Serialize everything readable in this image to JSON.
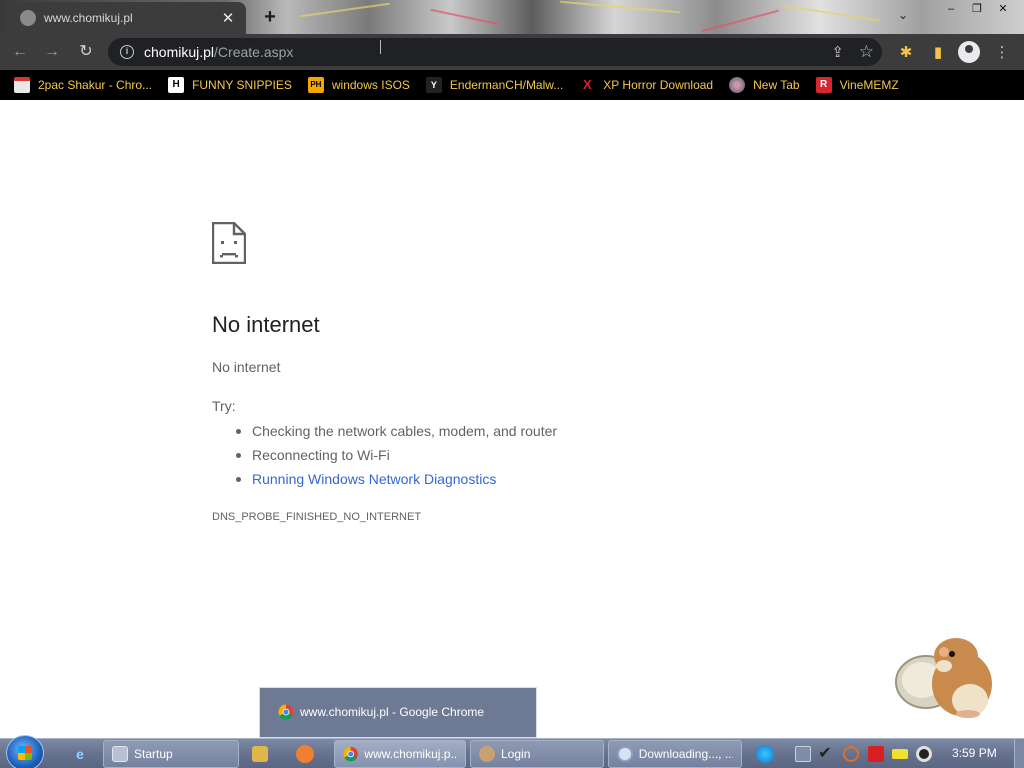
{
  "browser": {
    "tab": {
      "title": "www.chomikuj.pl"
    },
    "new_tab_symbol": "+",
    "window_controls": {
      "minimize": "–",
      "restore": "❐",
      "close": "✕"
    },
    "omnibox": {
      "host": "chomikuj.pl",
      "path": "/Create.aspx"
    },
    "bookmarks": [
      {
        "label": "2pac Shakur - Chro...",
        "icon": "calendar-icon"
      },
      {
        "label": "FUNNY SNIPPIES",
        "icon": "h-logo-icon",
        "glyph": "H"
      },
      {
        "label": "windows ISOS",
        "icon": "ph-logo-icon",
        "glyph": "PH"
      },
      {
        "label": "EndermanCH/Malw...",
        "icon": "yp-logo-icon",
        "glyph": "Y"
      },
      {
        "label": "XP Horror Download",
        "icon": "x-logo-icon",
        "glyph": "X"
      },
      {
        "label": "New Tab",
        "icon": "globe-icon"
      },
      {
        "label": "VineMEMZ",
        "icon": "r-logo-icon",
        "glyph": "R"
      }
    ]
  },
  "error_page": {
    "title": "No internet",
    "subtitle": "No internet",
    "try_label": "Try:",
    "suggestions": [
      "Checking the network cables, modem, and router",
      "Reconnecting to Wi-Fi",
      "Running Windows Network Diagnostics"
    ],
    "error_code": "DNS_PROBE_FINISHED_NO_INTERNET"
  },
  "taskbar": {
    "preview": {
      "label": "www.chomikuj.pl - Google Chrome"
    },
    "buttons": [
      {
        "label": "Startup",
        "icon": "startup-icon"
      },
      {
        "label": "www.chomikuj.p...",
        "icon": "chrome-icon"
      },
      {
        "label": "Login",
        "icon": "login-icon"
      },
      {
        "label": "Downloading..., ...",
        "icon": "download-icon"
      }
    ],
    "clock": "3:59 PM"
  },
  "colors": {
    "bookmark_text": "#f2c94c",
    "link": "#3367d6",
    "toolbar": "#3c3c3c"
  }
}
